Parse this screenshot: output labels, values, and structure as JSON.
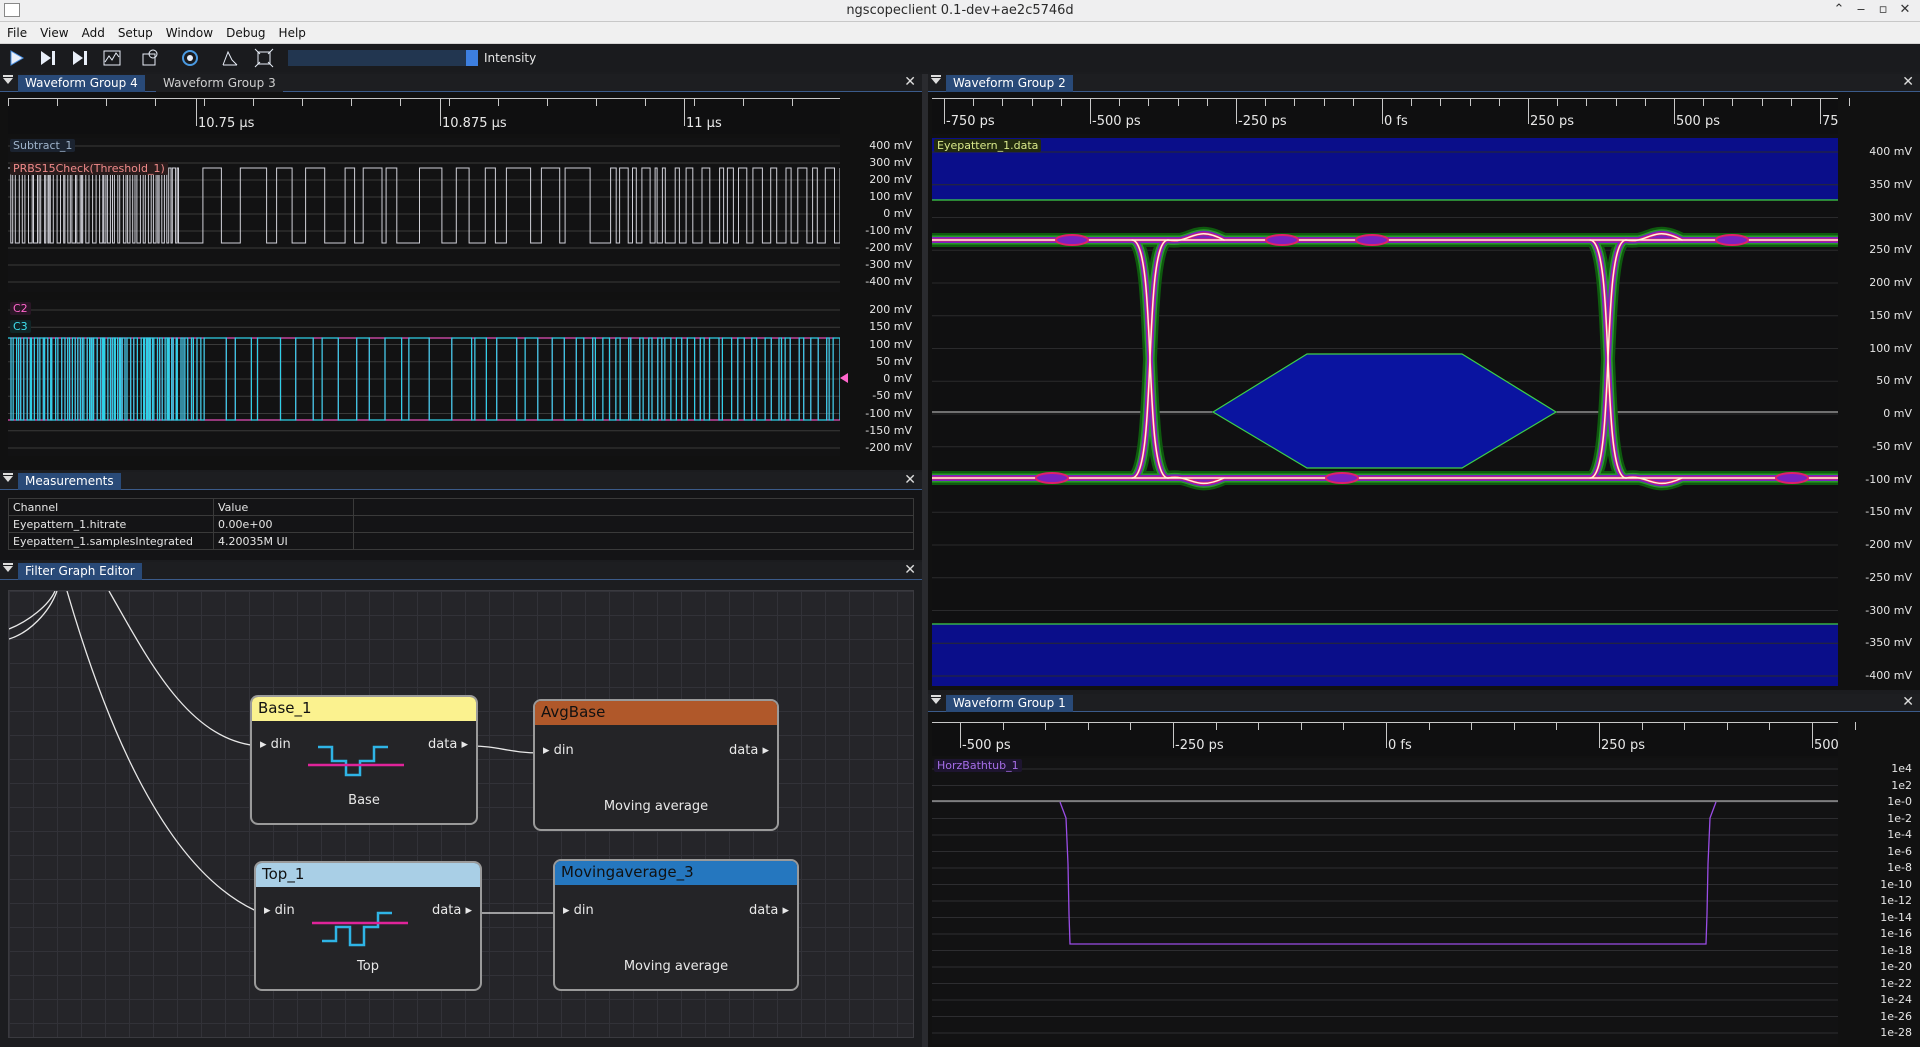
{
  "window": {
    "title": "ngscopeclient 0.1-dev+ae2c5746d"
  },
  "menu": [
    "File",
    "View",
    "Add",
    "Setup",
    "Window",
    "Debug",
    "Help"
  ],
  "toolbar": {
    "intensity_label": "Intensity",
    "intensity_level": 0.94,
    "icons": [
      "play-icon",
      "play-single-icon",
      "play-step-icon",
      "history-icon",
      "sync-icon",
      "refresh-icon",
      "cursor-icon",
      "fit-icon"
    ]
  },
  "wg4": {
    "tabs": [
      "Waveform Group 4",
      "Waveform Group 3"
    ],
    "ticks": [
      "10.75 µs",
      "10.875 µs",
      "11 µs"
    ],
    "upper": {
      "channels": [
        "Subtract_1",
        "PRBS15Check(Threshold_1)"
      ],
      "axis": [
        "400 mV",
        "300 mV",
        "200 mV",
        "100 mV",
        "0 mV",
        "-100 mV",
        "-200 mV",
        "-300 mV",
        "-400 mV"
      ]
    },
    "lower": {
      "channels": [
        "C2",
        "C3"
      ],
      "axis": [
        "200 mV",
        "150 mV",
        "100 mV",
        "50 mV",
        "0 mV",
        "-50 mV",
        "-100 mV",
        "-150 mV",
        "-200 mV"
      ]
    }
  },
  "measurements": {
    "title": "Measurements",
    "headers": [
      "Channel",
      "Value"
    ],
    "rows": [
      [
        "Eyepattern_1.hitrate",
        "0.00e+00"
      ],
      [
        "Eyepattern_1.samplesIntegrated",
        "4.20035M UI"
      ]
    ]
  },
  "filter_graph": {
    "title": "Filter Graph Editor",
    "nodes": [
      {
        "title": "Base_1",
        "color": "#fbf28f",
        "input": "din",
        "output": "data",
        "subtitle": "Base"
      },
      {
        "title": "AvgBase",
        "color": "#b0582a",
        "input": "din",
        "output": "data",
        "subtitle": "Moving average"
      },
      {
        "title": "Top_1",
        "color": "#a9cfe6",
        "input": "din",
        "output": "data",
        "subtitle": "Top"
      },
      {
        "title": "Movingaverage_3",
        "color": "#2577bf",
        "input": "din",
        "output": "data",
        "subtitle": "Moving average"
      }
    ]
  },
  "wg2": {
    "tab": "Waveform Group 2",
    "channel": "Eyepattern_1.data",
    "ticks": [
      "-750 ps",
      "-500 ps",
      "-250 ps",
      "0 fs",
      "250 ps",
      "500 ps",
      "75"
    ],
    "axis": [
      "400 mV",
      "350 mV",
      "300 mV",
      "250 mV",
      "200 mV",
      "150 mV",
      "100 mV",
      "50 mV",
      "0 mV",
      "-50 mV",
      "-100 mV",
      "-150 mV",
      "-200 mV",
      "-250 mV",
      "-300 mV",
      "-350 mV",
      "-400 mV"
    ]
  },
  "wg1": {
    "tab": "Waveform Group 1",
    "channel": "HorzBathtub_1",
    "ticks": [
      "-500 ps",
      "-250 ps",
      "0 fs",
      "250 ps",
      "500"
    ],
    "axis": [
      "1e4",
      "1e2",
      "1e-0",
      "1e-2",
      "1e-4",
      "1e-6",
      "1e-8",
      "1e-10",
      "1e-12",
      "1e-14",
      "1e-16",
      "1e-18",
      "1e-20",
      "1e-22",
      "1e-24",
      "1e-26",
      "1e-28"
    ]
  }
}
